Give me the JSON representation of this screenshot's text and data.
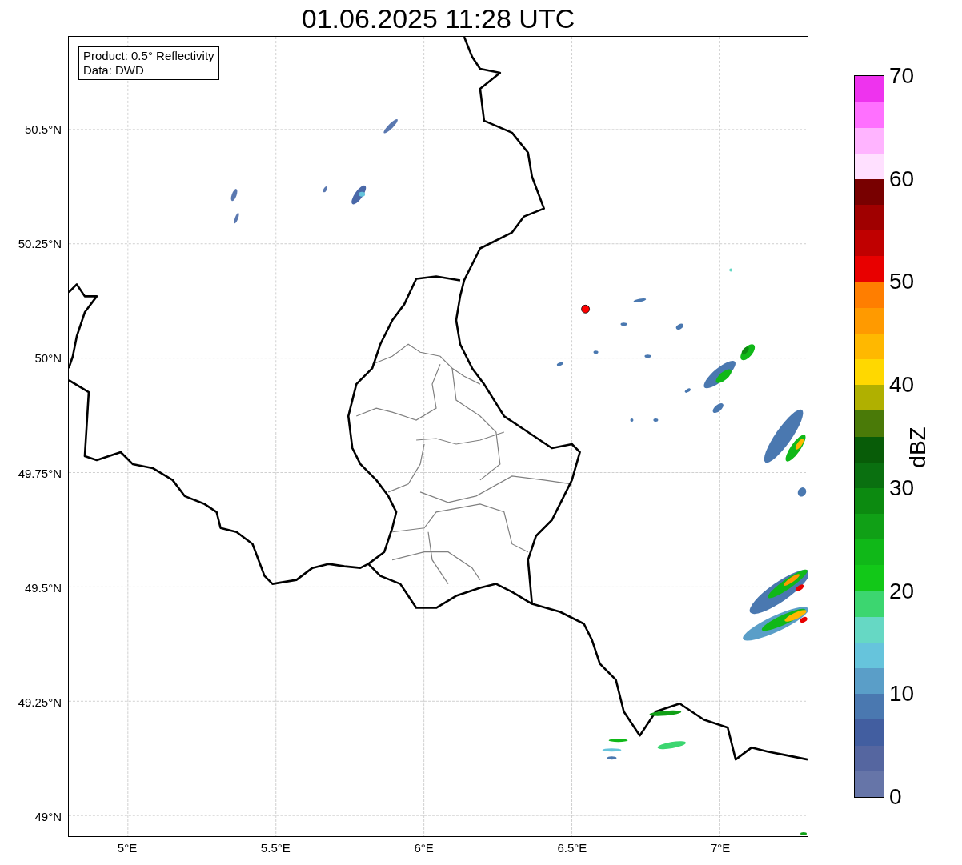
{
  "title": "01.06.2025 11:28 UTC",
  "legend_lines": [
    "Product: 0.5° Reflectivity",
    "Data: DWD"
  ],
  "map": {
    "yticks": [
      "50.5°N",
      "50.25°N",
      "50°N",
      "49.75°N",
      "49.5°N",
      "49.25°N",
      "49°N"
    ],
    "xticks": [
      "5°E",
      "5.5°E",
      "6°E",
      "6.5°E",
      "7°E"
    ]
  },
  "colorbar": {
    "label": "dBZ",
    "ticks": [
      "70",
      "60",
      "50",
      "40",
      "30",
      "20",
      "10",
      "0"
    ],
    "segments": [
      {
        "color": "#6675a8"
      },
      {
        "color": "#5566a0"
      },
      {
        "color": "#425ea0"
      },
      {
        "color": "#4a78b0"
      },
      {
        "color": "#5a9ec8"
      },
      {
        "color": "#66c4dc"
      },
      {
        "color": "#66d8c4"
      },
      {
        "color": "#3cd670"
      },
      {
        "color": "#12c818"
      },
      {
        "color": "#10b818"
      },
      {
        "color": "#10a016"
      },
      {
        "color": "#0c8a10"
      },
      {
        "color": "#0a7010"
      },
      {
        "color": "#085c08"
      },
      {
        "color": "#4a7a08"
      },
      {
        "color": "#b0b000"
      },
      {
        "color": "#ffd800"
      },
      {
        "color": "#ffb800"
      },
      {
        "color": "#ff9a00"
      },
      {
        "color": "#ff7e00"
      },
      {
        "color": "#e80000"
      },
      {
        "color": "#c00000"
      },
      {
        "color": "#a00000"
      },
      {
        "color": "#780000"
      },
      {
        "color": "#ffe0ff"
      },
      {
        "color": "#ffb4ff"
      },
      {
        "color": "#ff70ff"
      },
      {
        "color": "#ee33ee"
      }
    ]
  }
}
